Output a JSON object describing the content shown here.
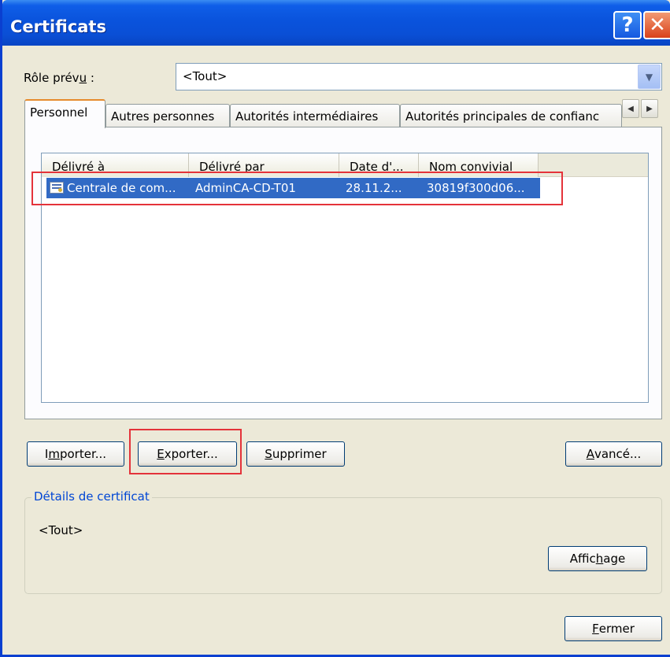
{
  "window": {
    "title": "Certificats",
    "help_label": "?",
    "close_label": "✕"
  },
  "role": {
    "label_pre": "Rôle prév",
    "label_key": "u",
    "label_post": " :",
    "value": "<Tout>"
  },
  "tabs": [
    {
      "label": "Personnel",
      "active": true
    },
    {
      "label": "Autres personnes"
    },
    {
      "label": "Autorités intermédiaires"
    },
    {
      "label": "Autorités principales de confianc"
    }
  ],
  "list": {
    "columns": [
      "Délivré à",
      "Délivré par",
      "Date d'...",
      "Nom convivial"
    ],
    "rows": [
      {
        "issued_to": "Centrale de com...",
        "issued_by": "AdminCA-CD-T01",
        "date": "28.11.2...",
        "friendly_name": "30819f300d06..."
      }
    ]
  },
  "buttons": {
    "import_pre": "I",
    "import_key": "m",
    "import_post": "porter...",
    "export_pre": "",
    "export_key": "E",
    "export_post": "xporter...",
    "delete_pre": "",
    "delete_key": "S",
    "delete_post": "upprimer",
    "advanced_pre": "",
    "advanced_key": "A",
    "advanced_post": "vancé...",
    "view_pre": "Affic",
    "view_key": "h",
    "view_post": "age",
    "close_pre": "",
    "close_key": "F",
    "close_post": "ermer"
  },
  "details": {
    "title": "Détails de certificat",
    "value": "<Tout>"
  },
  "colors": {
    "selection": "#316ac5",
    "highlight_box": "#e4333a",
    "titlebar": "#0a53dc"
  }
}
